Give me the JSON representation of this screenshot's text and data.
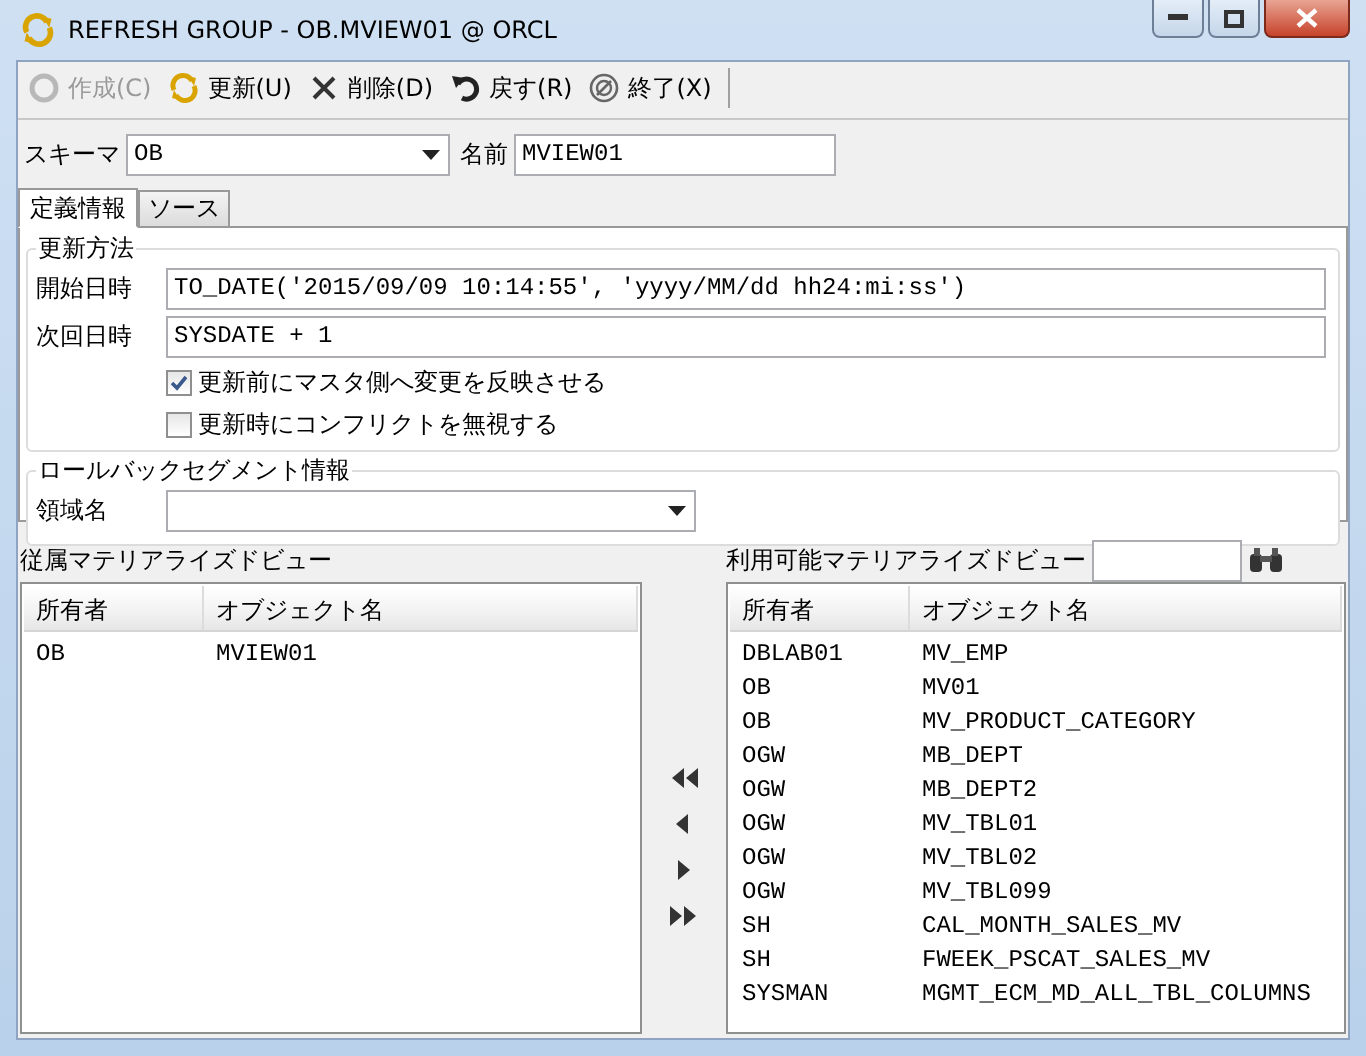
{
  "window": {
    "title": "REFRESH GROUP - OB.MVIEW01 @ ORCL"
  },
  "toolbar": [
    {
      "kind": "create",
      "label": "作成(C)",
      "disabled": true
    },
    {
      "kind": "refresh",
      "label": "更新(U)",
      "disabled": false
    },
    {
      "kind": "delete",
      "label": "削除(D)",
      "disabled": false
    },
    {
      "kind": "revert",
      "label": "戻す(R)",
      "disabled": false
    },
    {
      "kind": "exit",
      "label": "終了(X)",
      "disabled": false
    }
  ],
  "schema": {
    "label": "スキーマ",
    "value": "OB"
  },
  "name": {
    "label": "名前",
    "value": "MVIEW01"
  },
  "tabs": [
    {
      "label": "定義情報",
      "selected": true
    },
    {
      "label": "ソース",
      "selected": false
    }
  ],
  "refresh_method": {
    "title": "更新方法",
    "fields": [
      {
        "label": "開始日時",
        "value": "TO_DATE('2015/09/09 10:14:55', 'yyyy/MM/dd hh24:mi:ss')"
      },
      {
        "label": "次回日時",
        "value": "SYSDATE + 1"
      }
    ],
    "options": [
      {
        "label": "更新前にマスタ側へ変更を反映させる",
        "checked": true
      },
      {
        "label": "更新時にコンフリクトを無視する",
        "checked": false
      }
    ]
  },
  "rollback": {
    "title": "ロールバックセグメント情報",
    "label": "領域名"
  },
  "dependent": {
    "title": "従属マテリアライズドビュー",
    "columns": [
      "所有者",
      "オブジェクト名"
    ],
    "rows": [
      [
        "OB",
        "MVIEW01"
      ]
    ]
  },
  "available": {
    "title": "利用可能マテリアライズドビュー",
    "columns": [
      "所有者",
      "オブジェクト名"
    ],
    "rows": [
      [
        "DBLAB01",
        "MV_EMP"
      ],
      [
        "OB",
        "MV01"
      ],
      [
        "OB",
        "MV_PRODUCT_CATEGORY"
      ],
      [
        "OGW",
        "MB_DEPT"
      ],
      [
        "OGW",
        "MB_DEPT2"
      ],
      [
        "OGW",
        "MV_TBL01"
      ],
      [
        "OGW",
        "MV_TBL02"
      ],
      [
        "OGW",
        "MV_TBL099"
      ],
      [
        "SH",
        "CAL_MONTH_SALES_MV"
      ],
      [
        "SH",
        "FWEEK_PSCAT_SALES_MV"
      ],
      [
        "SYSMAN",
        "MGMT_ECM_MD_ALL_TBL_COLUMNS"
      ]
    ]
  }
}
